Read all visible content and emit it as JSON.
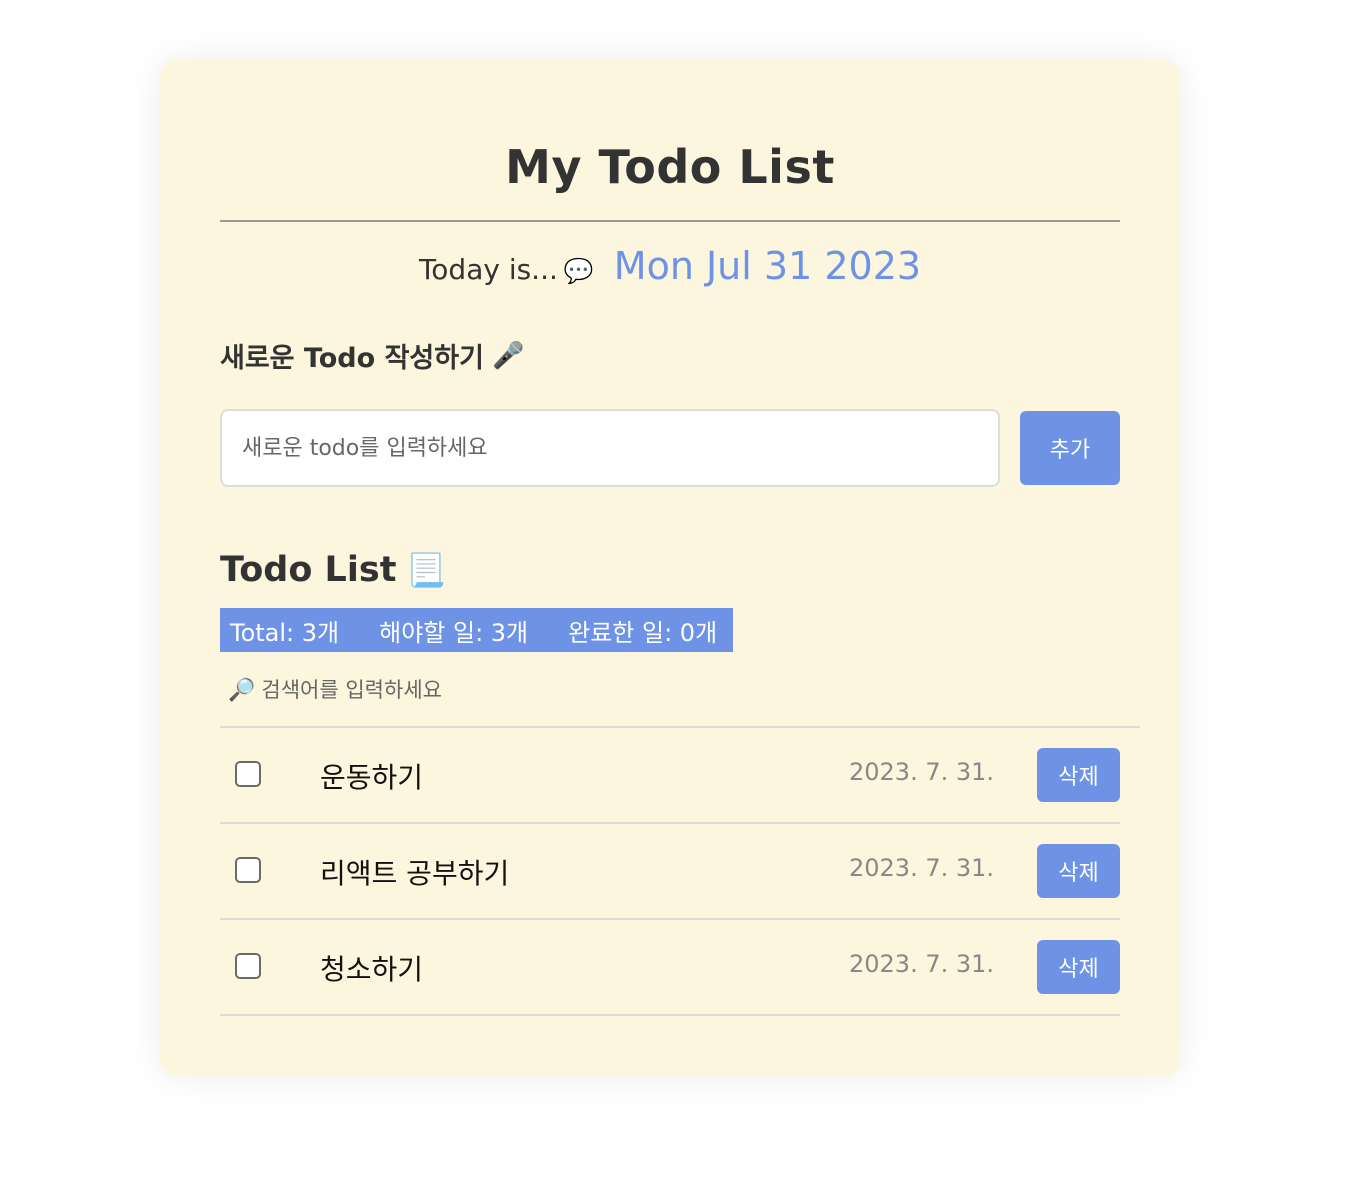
{
  "header": {
    "title": "My Todo List",
    "today_label": "Today is...",
    "today_icon": "speech-bubble-icon",
    "today_date": "Mon Jul 31 2023"
  },
  "editor": {
    "heading": "새로운 Todo 작성하기",
    "heading_icon": "microphone-icon",
    "input_placeholder": "새로운 todo를 입력하세요",
    "input_value": "",
    "add_label": "추가"
  },
  "list": {
    "heading": "Todo List",
    "heading_icon": "scroll-icon",
    "stats": {
      "total": "Total: 3개",
      "todo": "해야할 일: 3개",
      "done": "완료한 일: 0개"
    },
    "search_icon": "magnifier-icon",
    "search_placeholder": "검색어를 입력하세요",
    "items": [
      {
        "text": "운동하기",
        "date": "2023. 7. 31.",
        "checked": false,
        "delete_label": "삭제"
      },
      {
        "text": "리액트 공부하기",
        "date": "2023. 7. 31.",
        "checked": false,
        "delete_label": "삭제"
      },
      {
        "text": "청소하기",
        "date": "2023. 7. 31.",
        "checked": false,
        "delete_label": "삭제"
      }
    ]
  },
  "colors": {
    "card_background": "#fbf6dd",
    "accent": "#6e93e6",
    "text": "#333333"
  }
}
